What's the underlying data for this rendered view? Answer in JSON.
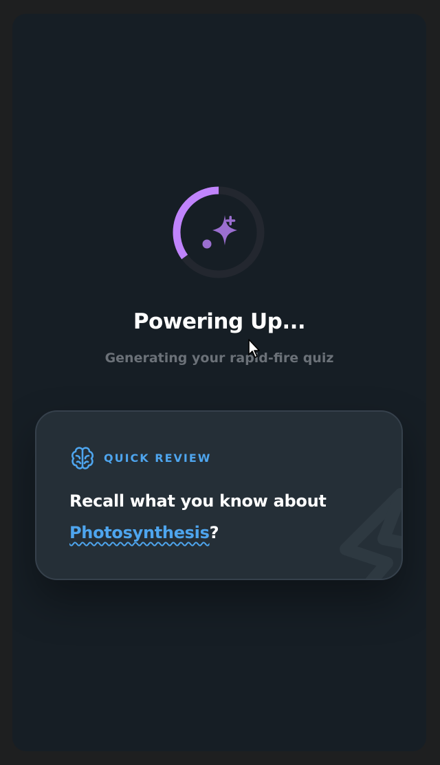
{
  "loading": {
    "title": "Powering Up...",
    "subtitle": "Generating your rapid-fire quiz",
    "progress": 0.35,
    "icon": "sparkles-icon"
  },
  "review_card": {
    "label": "QUICK REVIEW",
    "prompt_prefix": "Recall what you know about",
    "topic": "Photosynthesis",
    "prompt_suffix": "?",
    "header_icon": "brain-icon",
    "decor_icon": "lightning-bolt-icon"
  },
  "colors": {
    "background": "#161e25",
    "accent_purple": "#c084fc",
    "sparkle_purple": "#9b6fd0",
    "accent_blue": "#4ea5ee",
    "card_background": "#252f37",
    "muted_text": "#6b7178"
  }
}
